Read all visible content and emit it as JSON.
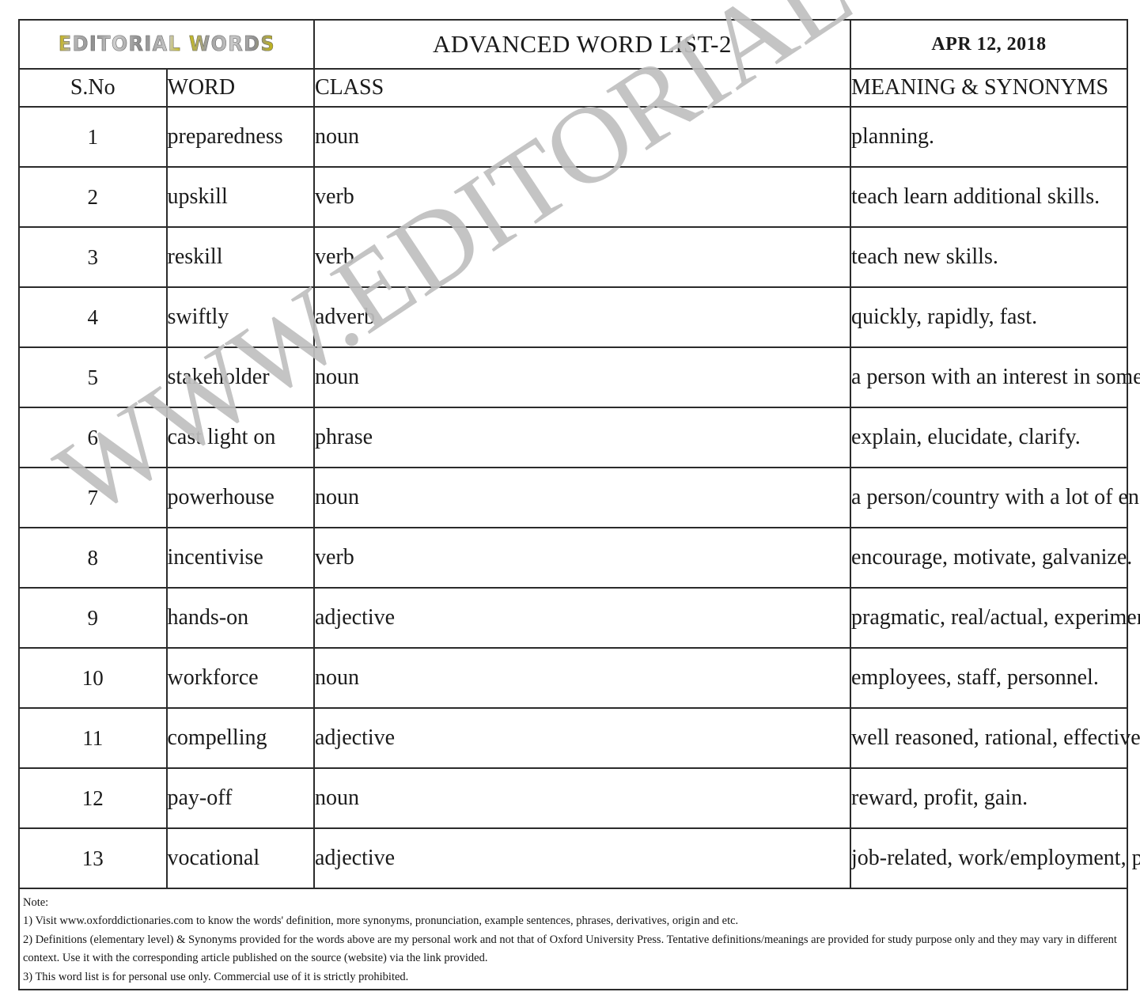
{
  "banner": {
    "logo_text": "EDITORIAL WORDS",
    "title": "ADVANCED WORD LIST-2",
    "date": "APR 12, 2018"
  },
  "watermark": {
    "text": "WWW.EDITORIALWORDS.COM",
    "color": "#bfbfbf"
  },
  "table": {
    "headers": {
      "sno": "S.No",
      "word": "WORD",
      "class": "CLASS",
      "meaning": "MEANING & SYNONYMS"
    },
    "rows": [
      {
        "sno": "1",
        "word": "preparedness",
        "class": "noun",
        "meaning": "planning."
      },
      {
        "sno": "2",
        "word": "upskill",
        "class": "verb",
        "meaning": "teach learn additional skills."
      },
      {
        "sno": "3",
        "word": "reskill",
        "class": "verb",
        "meaning": "teach new skills."
      },
      {
        "sno": "4",
        "word": "swiftly",
        "class": "adverb",
        "meaning": "quickly, rapidly, fast."
      },
      {
        "sno": "5",
        "word": "stakeholder",
        "class": "noun",
        "meaning": "a person with an interest in something."
      },
      {
        "sno": "6",
        "word": "cast light on",
        "class": "phrase",
        "meaning": "explain, elucidate, clarify."
      },
      {
        "sno": "7",
        "word": "powerhouse",
        "class": "noun",
        "meaning": "a person/country with a lot of energy, power & influence."
      },
      {
        "sno": "8",
        "word": "incentivise",
        "class": "verb",
        "meaning": "encourage, motivate, galvanize."
      },
      {
        "sno": "9",
        "word": "hands-on",
        "class": "adjective",
        "meaning": "pragmatic, real/actual, experimental."
      },
      {
        "sno": "10",
        "word": "workforce",
        "class": "noun",
        "meaning": "employees, staff, personnel."
      },
      {
        "sno": "11",
        "word": "compelling",
        "class": "adjective",
        "meaning": "well reasoned, rational, effective."
      },
      {
        "sno": "12",
        "word": "pay-off",
        "class": "noun",
        "meaning": "reward, profit, gain."
      },
      {
        "sno": "13",
        "word": "vocational",
        "class": "adjective",
        "meaning": "job-related, work/employment, professional."
      }
    ]
  },
  "notes": {
    "heading": "Note:",
    "items": [
      "1) Visit www.oxforddictionaries.com to know the words' definition, more synonyms, pronunciation, example sentences, phrases, derivatives, origin and etc.",
      "2) Definitions (elementary level) & Synonyms provided for the words above are my personal work and not that of Oxford University Press. Tentative definitions/meanings are provided for study purpose only and they may vary in different context. Use it with the corresponding article published on the source (website) via the link provided.",
      "3) This word list is for personal use only. Commercial use of it is strictly prohibited."
    ]
  }
}
